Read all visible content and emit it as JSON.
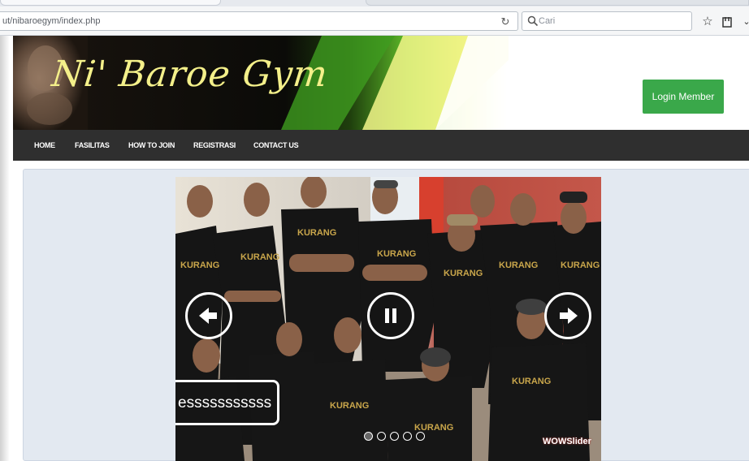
{
  "browser": {
    "url": "ut/nibaroegym/index.php",
    "search_placeholder": "Cari",
    "icons": [
      "reload-icon",
      "search-icon",
      "star-icon",
      "bookmark-list-icon",
      "overflow-chevron-icon"
    ]
  },
  "header": {
    "brand": "Ni' Baroe Gym",
    "login_label": "Login Member"
  },
  "menu": {
    "items": [
      {
        "label": "HOME"
      },
      {
        "label": "FASILITAS"
      },
      {
        "label": "HOW TO JOIN"
      },
      {
        "label": "REGISTRASI"
      },
      {
        "label": "CONTACT US"
      }
    ]
  },
  "slider": {
    "caption": "esssssssssss",
    "dot_count": 5,
    "active_dot": 1,
    "watermark": "WOWSlider",
    "controls": [
      "prev-arrow-icon",
      "pause-icon",
      "next-arrow-icon"
    ]
  },
  "colors": {
    "login_button": "#3aa84a",
    "menu_bar": "#2f2f2f",
    "content_panel": "#e3e9f1",
    "brand_text": "#f4f08a"
  }
}
